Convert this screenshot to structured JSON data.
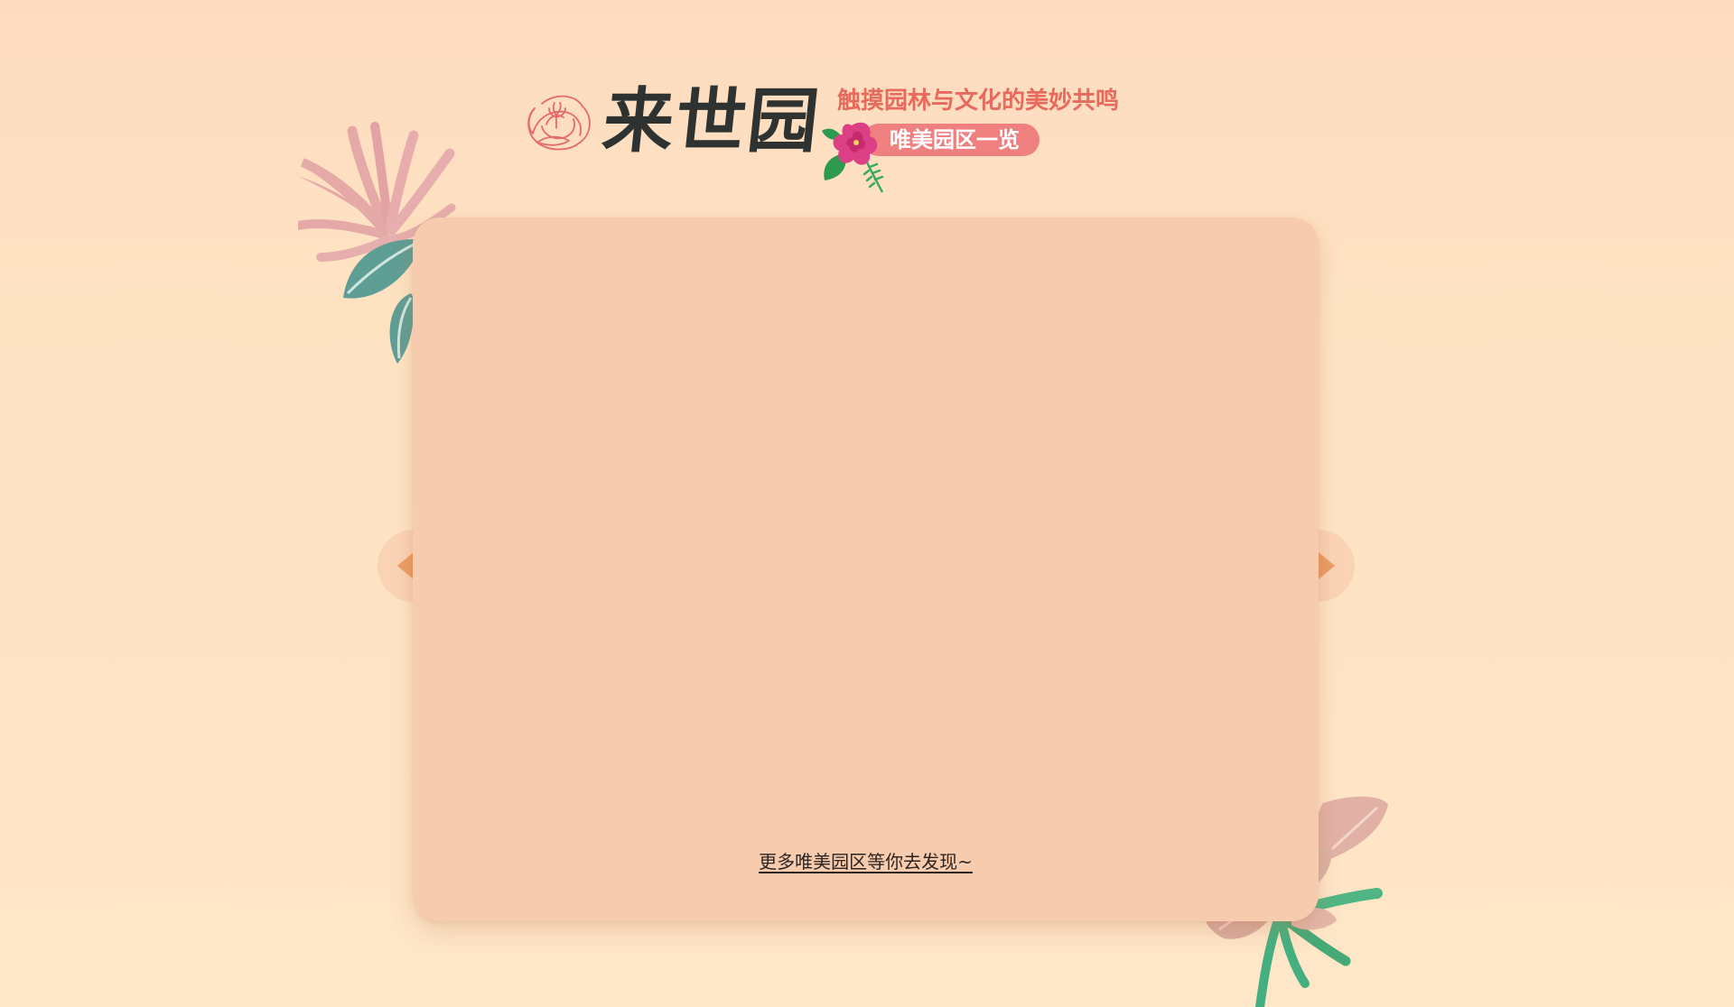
{
  "header": {
    "logo_text": "来世园",
    "slogan": "触摸园林与文化的美妙共鸣",
    "tag_label": "唯美园区一览"
  },
  "carousel": {
    "more_link_text": "更多唯美园区等你去发现~"
  },
  "icons": {
    "logo": "rose-outline-icon",
    "tag_decoration": "hibiscus-flower-icon",
    "prev": "triangle-left-icon",
    "next": "triangle-right-icon"
  },
  "colors": {
    "background": "#fee3c3",
    "card": "#f7cbad",
    "slogan": "#e86a5c",
    "tag_pill": "#f07f80",
    "arrow_icon": "#eb9c63",
    "logo_text": "#2e3230"
  }
}
